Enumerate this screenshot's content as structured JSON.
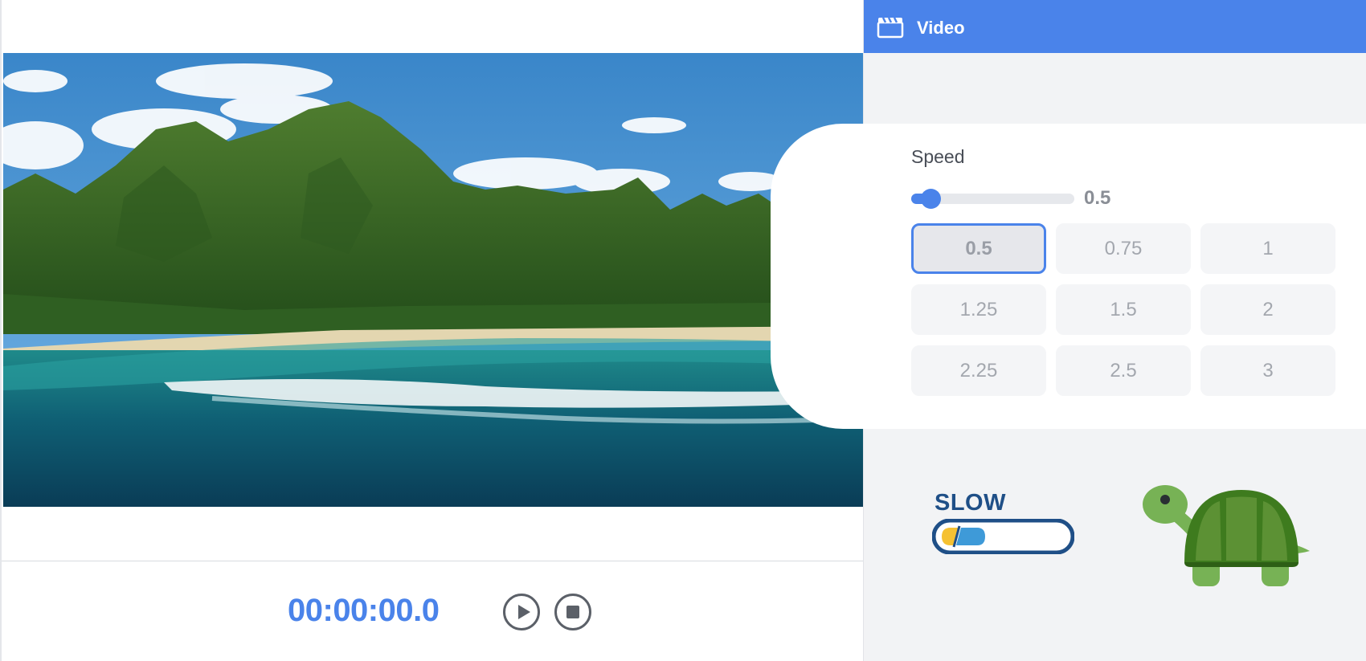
{
  "player": {
    "timecode": "00:00:00.0",
    "play_icon": "play-circle-icon",
    "stop_icon": "stop-circle-icon"
  },
  "panel": {
    "title": "Video",
    "icon": "clapperboard-icon",
    "accent_color": "#4a83ea"
  },
  "speed": {
    "label": "Speed",
    "value": "0.5",
    "slider_fraction": 0.0,
    "options": [
      "0.5",
      "0.75",
      "1",
      "1.25",
      "1.5",
      "2",
      "2.25",
      "2.5",
      "3"
    ],
    "selected_index": 0
  },
  "indicator": {
    "label": "SLOW",
    "mascot": "turtle-icon"
  }
}
